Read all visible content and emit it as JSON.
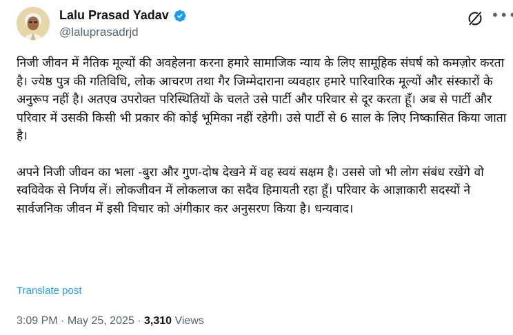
{
  "author": {
    "name": "Lalu Prasad Yadav",
    "handle": "@laluprasadrjd",
    "verified_color": "#1d9bf0"
  },
  "icons": {
    "grok": "grok-icon",
    "more": "more-options-icon",
    "verified": "verified-badge-icon"
  },
  "post": {
    "paragraphs": [
      "निजी जीवन में नैतिक मूल्यों की अवहेलना करना हमारे सामाजिक न्याय के लिए सामूहिक संघर्ष को कमज़ोर करता है। ज्येष्ठ पुत्र की गतिविधि, लोक आचरण तथा गैर जिम्मेदाराना व्यवहार हमारे पारिवारिक मूल्यों और संस्कारों के अनुरूप नहीं है। अतएव उपरोक्त परिस्थितियों के चलते उसे पार्टी और परिवार से दूर करता हूँ। अब से पार्टी और परिवार में उसकी किसी भी प्रकार की कोई भूमिका नहीं रहेगी। उसे पार्टी से 6 साल के लिए निष्कासित किया जाता है।",
      "अपने निजी जीवन का भला -बुरा और गुण-दोष देखने में वह स्वयं सक्षम है। उससे जो भी लोग संबंध रखेंगे वो स्वविवेक से निर्णय लें। लोकजीवन में लोकलाज का सदैव हिमायती रहा हूँ। परिवार के आज्ञाकारी सदस्यों ने सार्वजनिक जीवन में इसी विचार को अंगीकार कर अनुसरण किया है। धन्यवाद।"
    ],
    "translate_label": "Translate post"
  },
  "meta": {
    "time": "3:09 PM",
    "separator": " · ",
    "date": "May 25, 2025",
    "views_count": "3,310",
    "views_label": " Views"
  }
}
